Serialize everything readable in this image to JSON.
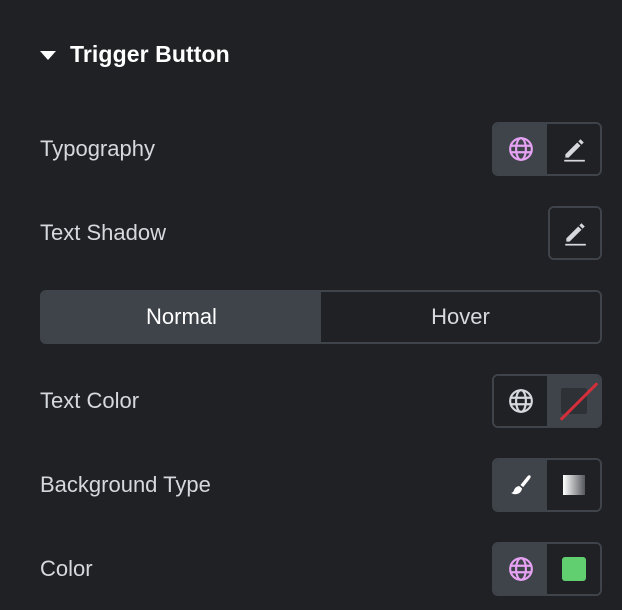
{
  "section": {
    "title": "Trigger Button",
    "expanded": true
  },
  "rows": {
    "typography": {
      "label": "Typography",
      "buttons": [
        "globe-icon",
        "pencil-icon"
      ]
    },
    "text_shadow": {
      "label": "Text Shadow",
      "buttons": [
        "pencil-icon"
      ]
    },
    "text_color": {
      "label": "Text Color",
      "buttons": [
        "globe-icon",
        "no-color-swatch"
      ]
    },
    "background_type": {
      "label": "Background Type",
      "buttons": [
        "brush-icon",
        "gradient-icon"
      ]
    },
    "color": {
      "label": "Color",
      "buttons": [
        "globe-icon",
        "color-swatch"
      ],
      "swatch_color": "#61ce70"
    }
  },
  "state_tabs": {
    "items": [
      {
        "label": "Normal",
        "active": true
      },
      {
        "label": "Hover",
        "active": false
      }
    ]
  },
  "colors": {
    "global_active": "#e6a2f2",
    "icon_default": "#d5d8dc",
    "no_color_line": "#d32f3a",
    "color_swatch": "#61ce70"
  }
}
